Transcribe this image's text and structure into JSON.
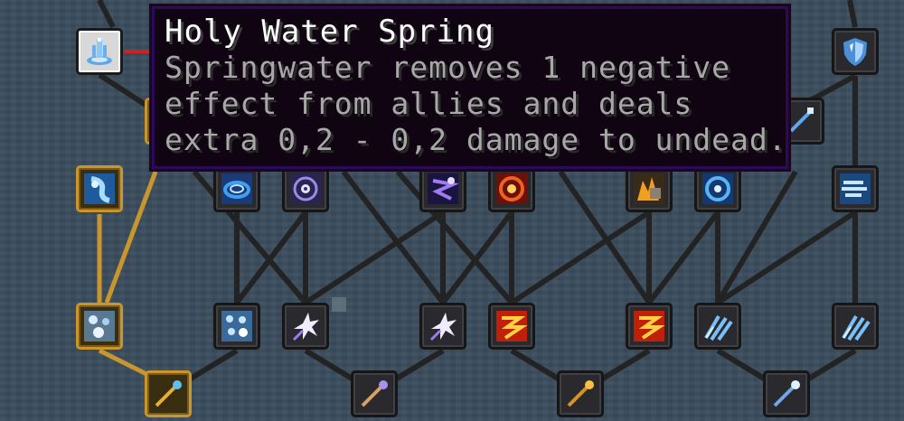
{
  "tooltip": {
    "title": "Holy Water Spring",
    "lines": [
      "Springwater removes 1 negative",
      "effect from allies and deals",
      "extra 0,2 - 0,2 damage to undead."
    ]
  },
  "colors": {
    "background": "#3a4c5c",
    "active_border": "#c8962c",
    "inactive_border": "#161616",
    "tooltip_bg": "#100312",
    "tooltip_border": "#2c0a5a"
  },
  "skill_nodes": [
    {
      "name": "holy-water-spring-node",
      "icon": "holy-water-spring-icon",
      "state": "root"
    },
    {
      "name": "water-swirl-node",
      "icon": "water-swirl-icon",
      "state": "active"
    },
    {
      "name": "frost-aura-node",
      "icon": "frost-aura-icon",
      "state": "active"
    },
    {
      "name": "golden-wand-node",
      "icon": "golden-wand-icon",
      "state": "active"
    },
    {
      "name": "shield-node",
      "icon": "shield-icon",
      "state": "locked"
    },
    {
      "name": "wind-gust-node",
      "icon": "wind-gust-icon",
      "state": "locked"
    },
    {
      "name": "water-ring-node",
      "icon": "water-ring-icon",
      "state": "locked"
    },
    {
      "name": "arcane-eye-node",
      "icon": "arcane-eye-icon",
      "state": "locked"
    },
    {
      "name": "void-rune-node",
      "icon": "void-rune-icon",
      "state": "locked"
    },
    {
      "name": "fire-ring-node",
      "icon": "fire-ring-icon",
      "state": "locked"
    },
    {
      "name": "flame-rock-node",
      "icon": "flame-rock-icon",
      "state": "locked"
    },
    {
      "name": "frost-ring-node",
      "icon": "frost-ring-icon",
      "state": "locked"
    },
    {
      "name": "frost-shards-node",
      "icon": "frost-shards-icon",
      "state": "locked"
    },
    {
      "name": "spark-burst-node",
      "icon": "spark-burst-icon",
      "state": "locked"
    },
    {
      "name": "spark-burst-2-node",
      "icon": "spark-burst-icon",
      "state": "locked"
    },
    {
      "name": "fire-swirl-node",
      "icon": "fire-swirl-icon",
      "state": "locked"
    },
    {
      "name": "fire-swirl-2-node",
      "icon": "fire-swirl-icon",
      "state": "locked"
    },
    {
      "name": "ice-claw-node",
      "icon": "ice-claw-icon",
      "state": "locked"
    },
    {
      "name": "ice-claw-2-node",
      "icon": "ice-claw-icon",
      "state": "locked"
    },
    {
      "name": "arcane-wand-node",
      "icon": "arcane-wand-icon",
      "state": "locked"
    },
    {
      "name": "fire-wand-node",
      "icon": "fire-wand-icon",
      "state": "locked"
    },
    {
      "name": "frost-wand-node",
      "icon": "frost-wand-icon",
      "state": "locked"
    },
    {
      "name": "partial-wand-node",
      "icon": "frost-wand-icon",
      "state": "locked"
    }
  ]
}
